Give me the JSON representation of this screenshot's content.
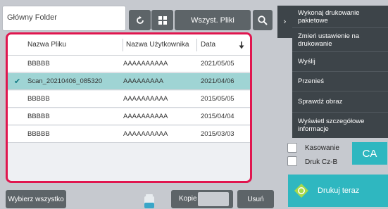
{
  "folder": {
    "title": "Główny Folder"
  },
  "toolbar": {
    "filter_label": "Wszyst. Pliki",
    "refresh_icon": "refresh-icon",
    "grid_icon": "grid-view-icon",
    "search_icon": "search-icon"
  },
  "table": {
    "headers": {
      "name": "Nazwa Pliku",
      "user": "Nazwa Użytkownika",
      "date": "Data",
      "sort_icon": "sort-down-arrow-icon"
    },
    "rows": [
      {
        "name": "BBBBB",
        "user": "AAAAAAAAAA",
        "date": "2021/05/05",
        "selected": false
      },
      {
        "name": "Scan_20210406_085320",
        "user": "AAAAAAAAA",
        "date": "2021/04/06",
        "selected": true
      },
      {
        "name": "BBBBB",
        "user": "AAAAAAAAAA",
        "date": "2015/05/05",
        "selected": false
      },
      {
        "name": "BBBBB",
        "user": "AAAAAAAAAA",
        "date": "2015/04/04",
        "selected": false
      },
      {
        "name": "BBBBB",
        "user": "AAAAAAAAAA",
        "date": "2015/03/03",
        "selected": false
      }
    ]
  },
  "bottom_bar": {
    "select_all": "Wybierz wszystko",
    "copies_label": "Kopie",
    "delete_label": "Usuń"
  },
  "right_panel": {
    "items": [
      "Wykonaj drukowanie pakietowe",
      "Zmień ustawienie na drukowanie",
      "Wyślij",
      "Przenieś",
      "Sprawdź obraz",
      "Wyświetl szczegółowe informacje"
    ]
  },
  "options": {
    "delete_checkbox": "Kasowanie",
    "duplex_checkbox": "Druk Cz-B"
  },
  "ca_label": "CA",
  "print_now_label": "Drukuj teraz",
  "colors": {
    "accent": "#2fb7c0",
    "highlight_frame": "#e0164f",
    "selected_row": "#9fd4d4",
    "dark_button": "#5d6468",
    "panel": "#3d4449"
  }
}
